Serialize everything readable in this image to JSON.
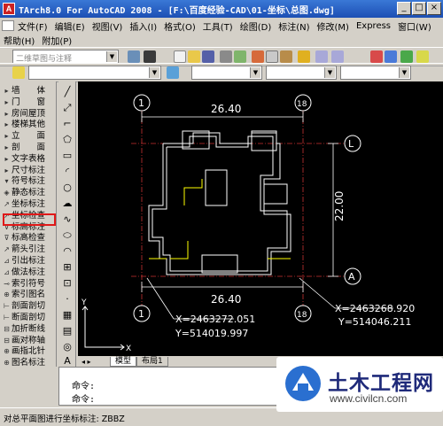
{
  "window": {
    "title": "TArch8.0 For AutoCAD 2008 - [F:\\百度经验-CAD\\01-坐标\\总图.dwg]"
  },
  "menu_row1": [
    "文件(F)",
    "编辑(E)",
    "视图(V)",
    "插入(I)",
    "格式(O)",
    "工具(T)",
    "绘图(D)",
    "标注(N)",
    "修改(M)",
    "Express",
    "窗口(W)"
  ],
  "menu_row2": [
    "帮助(H)",
    "附加(P)"
  ],
  "toolbar": {
    "workspace_combo": "二维草图与注释"
  },
  "left_panel": {
    "items": [
      {
        "glyph": "▸",
        "label": "墙　　体"
      },
      {
        "glyph": "▸",
        "label": "门　　窗"
      },
      {
        "glyph": "▸",
        "label": "房间屋顶"
      },
      {
        "glyph": "▸",
        "label": "楼梯其他"
      },
      {
        "glyph": "▸",
        "label": "立　　面"
      },
      {
        "glyph": "▸",
        "label": "剖　　面"
      },
      {
        "glyph": "▸",
        "label": "文字表格"
      },
      {
        "glyph": "▸",
        "label": "尺寸标注"
      },
      {
        "glyph": "▾",
        "label": "符号标注"
      },
      {
        "glyph": "◈",
        "label": "静态标注"
      },
      {
        "glyph": "↗",
        "label": "坐标标注"
      },
      {
        "glyph": "↗",
        "label": "坐标检查"
      },
      {
        "glyph": "⊽",
        "label": "标高标注"
      },
      {
        "glyph": "⊽",
        "label": "标高检查"
      },
      {
        "glyph": "↗",
        "label": "箭头引注"
      },
      {
        "glyph": "⊿",
        "label": "引出标注"
      },
      {
        "glyph": "⊿",
        "label": "做法标注"
      },
      {
        "glyph": "⊸",
        "label": "索引符号"
      },
      {
        "glyph": "⊕",
        "label": "索引图名"
      },
      {
        "glyph": "⊢",
        "label": "剖面剖切"
      },
      {
        "glyph": "⊢",
        "label": "断面剖切"
      },
      {
        "glyph": "⊟",
        "label": "加折断线"
      },
      {
        "glyph": "⊟",
        "label": "画对称轴"
      },
      {
        "glyph": "⊕",
        "label": "画指北针"
      },
      {
        "glyph": "⊕",
        "label": "图名标注"
      }
    ],
    "highlighted_item": "坐标标注"
  },
  "drawing": {
    "dims_top": "26.40",
    "dims_bottom": "26.40",
    "dim_right": "22.00",
    "axis_1": "1",
    "axis_18": "18",
    "axis_L": "L",
    "axis_A": "A",
    "coord_left": {
      "x": "X=2463272.051",
      "y": "Y=514019.997"
    },
    "coord_right": {
      "x": "X=2463268.920",
      "y": "Y=514046.211"
    },
    "ucs_x": "X",
    "ucs_y": "Y"
  },
  "tabs": [
    "模型",
    "布局1"
  ],
  "command": {
    "line1": "命令:",
    "line2": "命令:"
  },
  "status": {
    "text": "对总平面图进行坐标标注: ZBBZ"
  },
  "watermark": {
    "name": "土木工程网",
    "url": "www.civilcn.com"
  },
  "colors": {
    "highlight": "#e01818",
    "canvas": "#000000",
    "titlebar": "#1c4fb4",
    "building": "#ffffff",
    "dim": "#ffff00",
    "grid": "#c83232"
  }
}
